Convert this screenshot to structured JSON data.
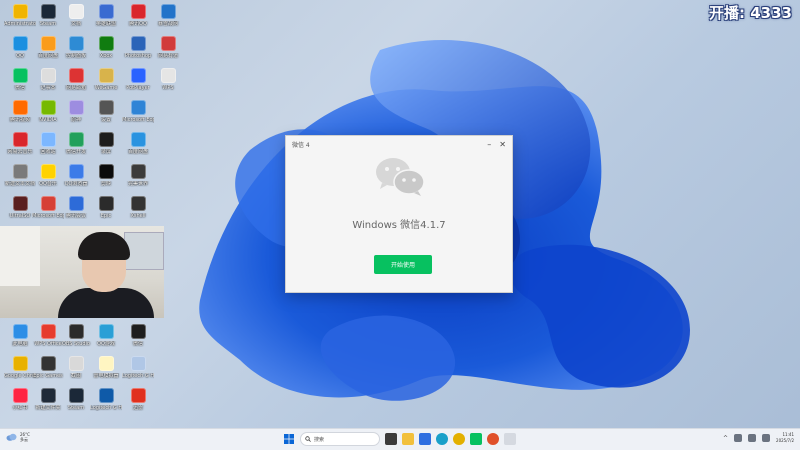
{
  "overlay": {
    "score_text": "开播: 4333"
  },
  "dialog": {
    "title": "微信 4",
    "version_text": "Windows 微信4.1.7",
    "primary_button": "开始使用",
    "min_icon": "minimize-icon",
    "close_icon": "close-icon"
  },
  "taskbar": {
    "weather": {
      "temp": "26°C",
      "desc": "多云"
    },
    "search_placeholder": "搜索",
    "clock": {
      "time": "11:41",
      "date": "2025/7/2"
    }
  },
  "colors": {
    "accent_green": "#07c160",
    "wallpaper_blue": "#1a5ad9",
    "taskbar_bg": "#eef1f6"
  },
  "desktop_icons": [
    {
      "label": "Administrator",
      "color": "#f0b400"
    },
    {
      "label": "QQ",
      "color": "#1b8fe0"
    },
    {
      "label": "微信",
      "color": "#07c160"
    },
    {
      "label": "腾讯视频",
      "color": "#ff6a00"
    },
    {
      "label": "网易云音乐",
      "color": "#d9262c"
    },
    {
      "label": "新建文本文档",
      "color": "#7a7a7a"
    },
    {
      "label": "UltraISO",
      "color": "#5a1f1f"
    },
    {
      "label": "此电脑",
      "color": "#2d8ee6"
    },
    {
      "label": "Google Chrome",
      "color": "#e8b100"
    },
    {
      "label": "小红书",
      "color": "#ff2442"
    },
    {
      "label": "Steam",
      "color": "#1b2838"
    },
    {
      "label": "百度网盘",
      "color": "#fa9c1c"
    },
    {
      "label": "记事本",
      "color": "#dddddd"
    },
    {
      "label": "NVIDIA",
      "color": "#76b900"
    },
    {
      "label": "回收站",
      "color": "#7cb7ff"
    },
    {
      "label": "QQ音乐",
      "color": "#ffd200"
    },
    {
      "label": "Microsoft Edge",
      "color": "#d64036"
    },
    {
      "label": "WPS Office",
      "color": "#e63c2e"
    },
    {
      "label": "Epic Games",
      "color": "#333333"
    },
    {
      "label": "新建文件夹",
      "color": "#1f2a38"
    },
    {
      "label": "文档",
      "color": "#eeeeee"
    },
    {
      "label": "控制面板",
      "color": "#2e8bd4"
    },
    {
      "label": "网易邮箱",
      "color": "#d33"
    },
    {
      "label": "原神",
      "color": "#9d8de0"
    },
    {
      "label": "微信开发",
      "color": "#22a05b"
    },
    {
      "label": "QQ浏览器",
      "color": "#3c7be8"
    },
    {
      "label": "腾讯会议",
      "color": "#2d6bd8"
    },
    {
      "label": "OBS Studio",
      "color": "#2b2b2b"
    },
    {
      "label": "截图",
      "color": "#d9d9d9"
    },
    {
      "label": "Steam",
      "color": "#1b2838"
    },
    {
      "label": "英雄联盟",
      "color": "#3a6bd1"
    },
    {
      "label": "Xbox",
      "color": "#107c10"
    },
    {
      "label": "WeGame",
      "color": "#d8b34b"
    },
    {
      "label": "设置",
      "color": "#555555"
    },
    {
      "label": "录屏",
      "color": "#1d1d1d"
    },
    {
      "label": "剪映",
      "color": "#0b0b0b"
    },
    {
      "label": "Epic",
      "color": "#2b2b2b"
    },
    {
      "label": "QQ游戏",
      "color": "#2a9fd6"
    },
    {
      "label": "雷电模拟器",
      "color": "#fff5c2"
    },
    {
      "label": "Logitech G HUB",
      "color": "#0f5aa8"
    },
    {
      "label": "腾讯QQ",
      "color": "#d9262c"
    },
    {
      "label": "Photoshop",
      "color": "#2b64b8"
    },
    {
      "label": "PotPlayer",
      "color": "#2a63ff"
    },
    {
      "label": "Microsoft Edge",
      "color": "#2f84d6"
    },
    {
      "label": "百度网盘",
      "color": "#2a93e0"
    },
    {
      "label": "完美世界",
      "color": "#3b3b3b"
    },
    {
      "label": "Xshell",
      "color": "#333333"
    },
    {
      "label": "微信",
      "color": "#1e1e1e"
    },
    {
      "label": "Logitech G HUB",
      "color": "#b0c7e6"
    },
    {
      "label": "迅雷",
      "color": "#e0301e"
    },
    {
      "label": "暴雪战网",
      "color": "#2273c9"
    },
    {
      "label": "网易有道",
      "color": "#d13b3b"
    },
    {
      "label": "WPS",
      "color": "#e5e5e5"
    }
  ]
}
